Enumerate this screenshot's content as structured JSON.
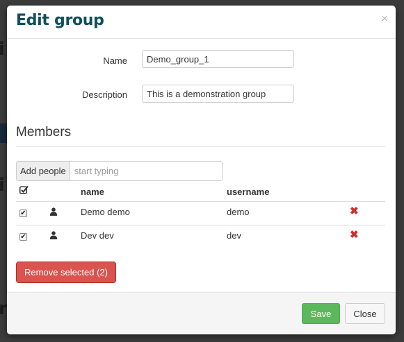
{
  "modal": {
    "title": "Edit group",
    "close_glyph": "×"
  },
  "form": {
    "name_label": "Name",
    "name_value": "Demo_group_1",
    "description_label": "Description",
    "description_value": "This is a demonstration group"
  },
  "members": {
    "section_title": "Members",
    "add_button_label": "Add people",
    "add_placeholder": "start typing",
    "columns": {
      "name": "name",
      "username": "username"
    },
    "header_check_icon": "check-square-icon",
    "rows": [
      {
        "checked": true,
        "icon": "user-icon",
        "name": "Demo demo",
        "username": "demo",
        "remove_icon": "remove-icon"
      },
      {
        "checked": true,
        "icon": "user-icon",
        "name": "Dev dev",
        "username": "dev",
        "remove_icon": "remove-icon"
      }
    ],
    "remove_selected_label": "Remove selected (2)"
  },
  "footer": {
    "save_label": "Save",
    "close_label": "Close"
  },
  "colors": {
    "title": "#0f4f5c",
    "danger": "#d9534f",
    "success": "#5cb85c",
    "remove_icon": "#c9302c"
  }
}
